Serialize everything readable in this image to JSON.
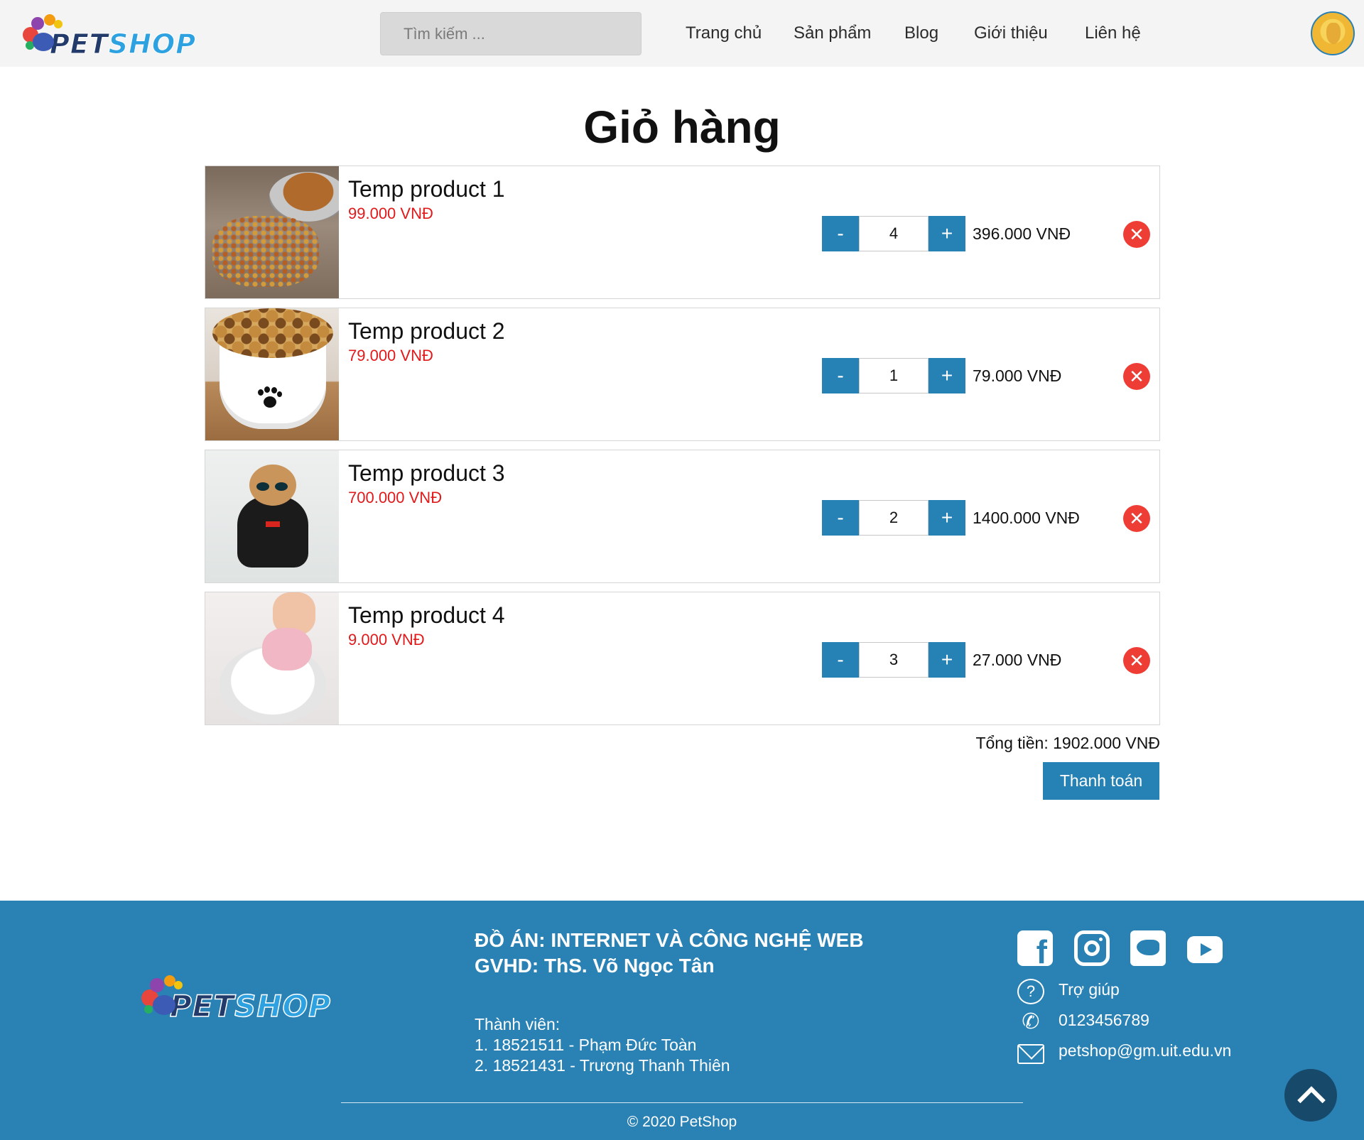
{
  "header": {
    "logo": {
      "part1": "PET",
      "part2": "SHOP"
    },
    "search_placeholder": "Tìm kiếm ...",
    "nav": [
      "Trang chủ",
      "Sản phẩm",
      "Blog",
      "Giới thiệu",
      "Liên hệ"
    ]
  },
  "cart": {
    "title": "Giỏ hàng",
    "items": [
      {
        "name": "Temp product 1",
        "price": "99.000 VNĐ",
        "quantity": "4",
        "line_total": "396.000 VNĐ"
      },
      {
        "name": "Temp product 2",
        "price": "79.000 VNĐ",
        "quantity": "1",
        "line_total": "79.000 VNĐ"
      },
      {
        "name": "Temp product 3",
        "price": "700.000 VNĐ",
        "quantity": "2",
        "line_total": "1400.000 VNĐ"
      },
      {
        "name": "Temp product 4",
        "price": "9.000 VNĐ",
        "quantity": "3",
        "line_total": "27.000 VNĐ"
      }
    ],
    "minus_label": "-",
    "plus_label": "+",
    "remove_label": "✕",
    "total": "Tổng tiền: 1902.000 VNĐ",
    "checkout_label": "Thanh toán"
  },
  "footer": {
    "logo": {
      "part1": "PET",
      "part2": "SHOP"
    },
    "title_line1": "ĐỒ ÁN: INTERNET VÀ CÔNG NGHỆ WEB",
    "title_line2": "GVHD: ThS. Võ Ngọc Tân",
    "members_heading": "Thành viên:",
    "members": [
      "1. 18521511 - Phạm Đức Toàn",
      "2. 18521431 - Trương Thanh Thiên"
    ],
    "social_icons": [
      "facebook-icon",
      "instagram-icon",
      "twitter-icon",
      "youtube-icon"
    ],
    "facebook_glyph": "f",
    "contacts": {
      "help": "Trợ giúp",
      "phone": "0123456789",
      "email": "petshop@gm.uit.edu.vn",
      "help_glyph": "?",
      "phone_glyph": "✆"
    },
    "copyright": "© 2020 PetShop"
  },
  "colors": {
    "accent": "#2681b5",
    "footer_bg": "#2981b4",
    "price": "#e0191b",
    "remove": "#ee3d35",
    "scroll_top": "#17496a"
  }
}
